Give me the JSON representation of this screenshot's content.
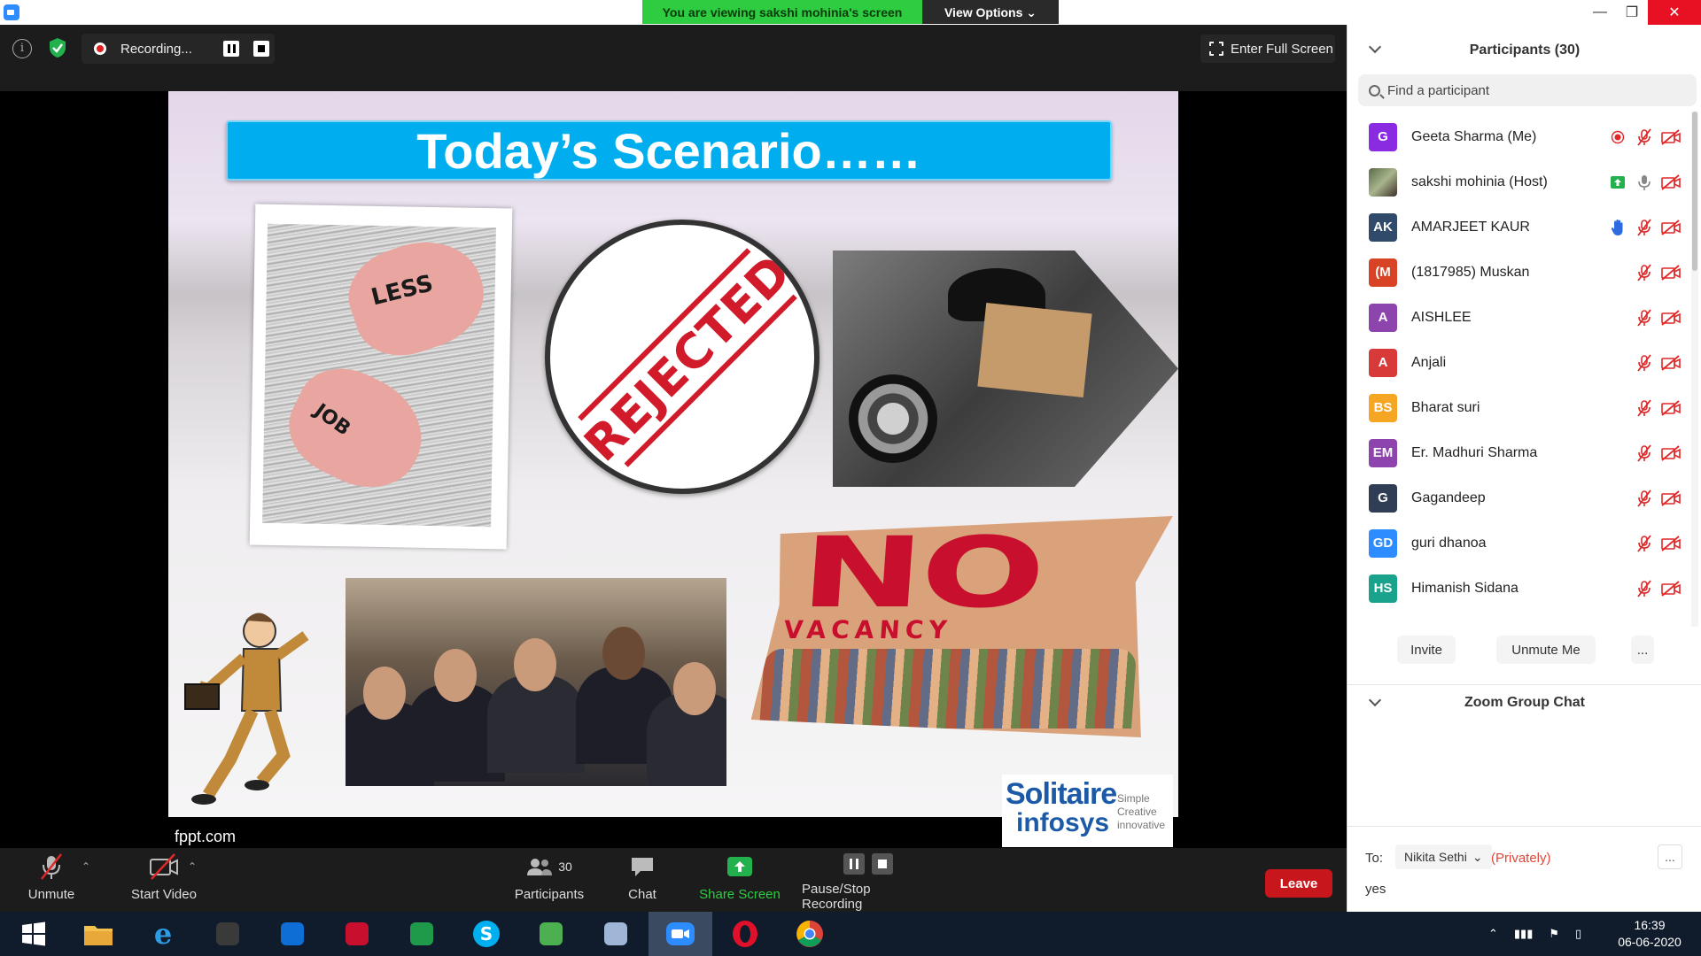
{
  "banner": {
    "viewing_text": "You are viewing sakshi mohinia's screen",
    "view_options": "View Options"
  },
  "recording": {
    "status": "Recording...",
    "enter_full_screen": "Enter Full Screen"
  },
  "slide": {
    "title": "Today’s Scenario……",
    "hand_word_1": "LESS",
    "hand_word_2": "JOB",
    "stamp": "REJECTED",
    "no_vacancy_big": "NO",
    "no_vacancy_small": "VACANCY",
    "footer_site": "fppt.com",
    "logo_main": "Solitaire",
    "logo_sub": "infosys",
    "logo_tag_1": "Simple",
    "logo_tag_2": "Creative",
    "logo_tag_3": "innovative"
  },
  "toolbar": {
    "unmute": "Unmute",
    "start_video": "Start Video",
    "participants": "Participants",
    "participants_count": "30",
    "chat": "Chat",
    "share_screen": "Share Screen",
    "pause_stop_recording": "Pause/Stop Recording",
    "leave": "Leave"
  },
  "panel": {
    "title": "Participants (30)",
    "search_placeholder": "Find a participant",
    "participants": [
      {
        "initials": "G",
        "name": "Geeta Sharma (Me)",
        "color": "#8a2be2",
        "status": "recording"
      },
      {
        "initials": "",
        "name": "sakshi mohinia (Host)",
        "color": "#6b7b5a",
        "status": "sharing"
      },
      {
        "initials": "AK",
        "name": "AMARJEET KAUR",
        "color": "#2f4a6b",
        "status": "hand"
      },
      {
        "initials": "(M",
        "name": "(1817985) Muskan",
        "color": "#d84325",
        "status": "muted"
      },
      {
        "initials": "A",
        "name": "AISHLEE",
        "color": "#8e44ad",
        "status": "muted"
      },
      {
        "initials": "A",
        "name": "Anjali",
        "color": "#d83a3a",
        "status": "muted"
      },
      {
        "initials": "BS",
        "name": "Bharat suri",
        "color": "#f5a623",
        "status": "muted"
      },
      {
        "initials": "EM",
        "name": "Er. Madhuri Sharma",
        "color": "#8e44ad",
        "status": "muted"
      },
      {
        "initials": "G",
        "name": "Gagandeep",
        "color": "#2f3e55",
        "status": "muted"
      },
      {
        "initials": "GD",
        "name": "guri dhanoa",
        "color": "#2d8cff",
        "status": "muted"
      },
      {
        "initials": "HS",
        "name": "Himanish Sidana",
        "color": "#1aa38c",
        "status": "muted"
      }
    ],
    "invite": "Invite",
    "unmute_me": "Unmute Me",
    "more": "...",
    "chat_title": "Zoom Group Chat",
    "to_label": "To:",
    "to_value": "Nikita Sethi",
    "privately": "(Privately)",
    "chat_more": "...",
    "chat_input": "yes"
  },
  "taskbar": {
    "apps": [
      "windows-start",
      "file-explorer",
      "internet-explorer",
      "hypercam",
      "teamviewer",
      "mendeley",
      "green-circle-app",
      "skype",
      "camtasia",
      "envelope-app",
      "zoom",
      "opera",
      "chrome"
    ],
    "active_app": "zoom",
    "time": "16:39",
    "date": "06-06-2020"
  }
}
